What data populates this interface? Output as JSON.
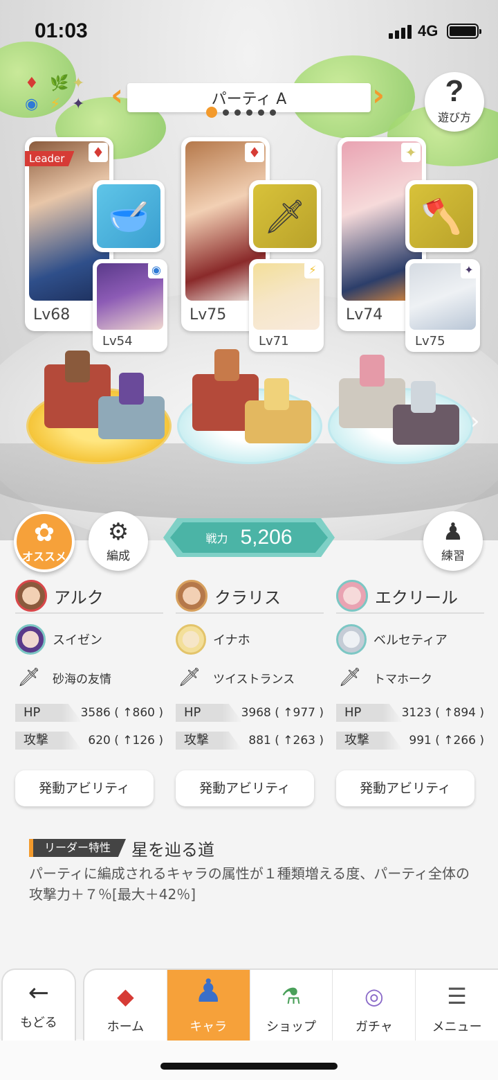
{
  "status_bar": {
    "time": "01:03",
    "network": "4G",
    "battery_level": 1.0
  },
  "element_key": {
    "symbols": [
      "♦",
      "🌿",
      "✦",
      "◉",
      "⚡",
      "✦"
    ]
  },
  "party": {
    "title": "パーティ A",
    "prev_icon": "chevron-left-icon",
    "next_icon": "chevron-right-icon",
    "page_count": 6,
    "current_page": 1
  },
  "help": {
    "label": "遊び方",
    "icon": "question-icon"
  },
  "leader_tag": "Leader",
  "cards": [
    {
      "main_level": "Lv68",
      "sub_level": "Lv54",
      "main_attr_icon": "fire-diamond-icon",
      "sub_attr_icon": "water-orb-icon",
      "weapon_icon": "gold-bowl-icon",
      "main_attr": "♦",
      "sub_attr": "◉",
      "weapon": "🥣"
    },
    {
      "main_level": "Lv75",
      "sub_level": "Lv71",
      "main_attr_icon": "fire-diamond-icon",
      "sub_attr_icon": "thunder-icon",
      "weapon_icon": "spear-icon",
      "main_attr": "♦",
      "sub_attr": "⚡",
      "weapon": "🗡"
    },
    {
      "main_level": "Lv74",
      "sub_level": "Lv75",
      "main_attr_icon": "light-star-icon",
      "sub_attr_icon": "dark-star-icon",
      "weapon_icon": "tomahawk-icon",
      "main_attr": "✦",
      "sub_attr": "✦",
      "weapon": "🪓"
    }
  ],
  "controls": {
    "recommend_label": "オススメ",
    "formation_label": "編成",
    "practice_label": "練習",
    "power_label": "戦力",
    "power_value": "5,206"
  },
  "characters": [
    {
      "name": "アルク",
      "sub_name": "スイゼン",
      "weapon": "砂海の友情",
      "hp_label": "HP",
      "hp": "3586 ( ↑860 )",
      "atk_label": "攻撃",
      "atk": "620 ( ↑126 )",
      "ability": "発動アビリティ"
    },
    {
      "name": "クラリス",
      "sub_name": "イナホ",
      "weapon": "ツイストランス",
      "hp_label": "HP",
      "hp": "3968 ( ↑977 )",
      "atk_label": "攻撃",
      "atk": "881 ( ↑263 )",
      "ability": "発動アビリティ"
    },
    {
      "name": "エクリール",
      "sub_name": "ベルセティア",
      "weapon": "トマホーク",
      "hp_label": "HP",
      "hp": "3123 ( ↑894 )",
      "atk_label": "攻撃",
      "atk": "991 ( ↑266 )",
      "ability": "発動アビリティ"
    }
  ],
  "leader_trait": {
    "label": "リーダー特性",
    "title": "星を辿る道",
    "description": "パーティに編成されるキャラの属性が１種類増える度、パーティ全体の攻撃力＋７％[最大＋42％]"
  },
  "nav": {
    "back_label": "もどる",
    "tabs": [
      {
        "label": "ホーム",
        "icon": "home-icon",
        "glyph": "◆"
      },
      {
        "label": "キャラ",
        "icon": "character-icon",
        "glyph": "♟"
      },
      {
        "label": "ショップ",
        "icon": "shop-icon",
        "glyph": "⚗"
      },
      {
        "label": "ガチャ",
        "icon": "gacha-icon",
        "glyph": "◎"
      },
      {
        "label": "メニュー",
        "icon": "menu-icon",
        "glyph": "☰"
      }
    ],
    "active_tab": "キャラ"
  },
  "colors": {
    "accent": "#f39a2c",
    "power_badge": "#4bb4a6",
    "fire": "#d63b35"
  }
}
